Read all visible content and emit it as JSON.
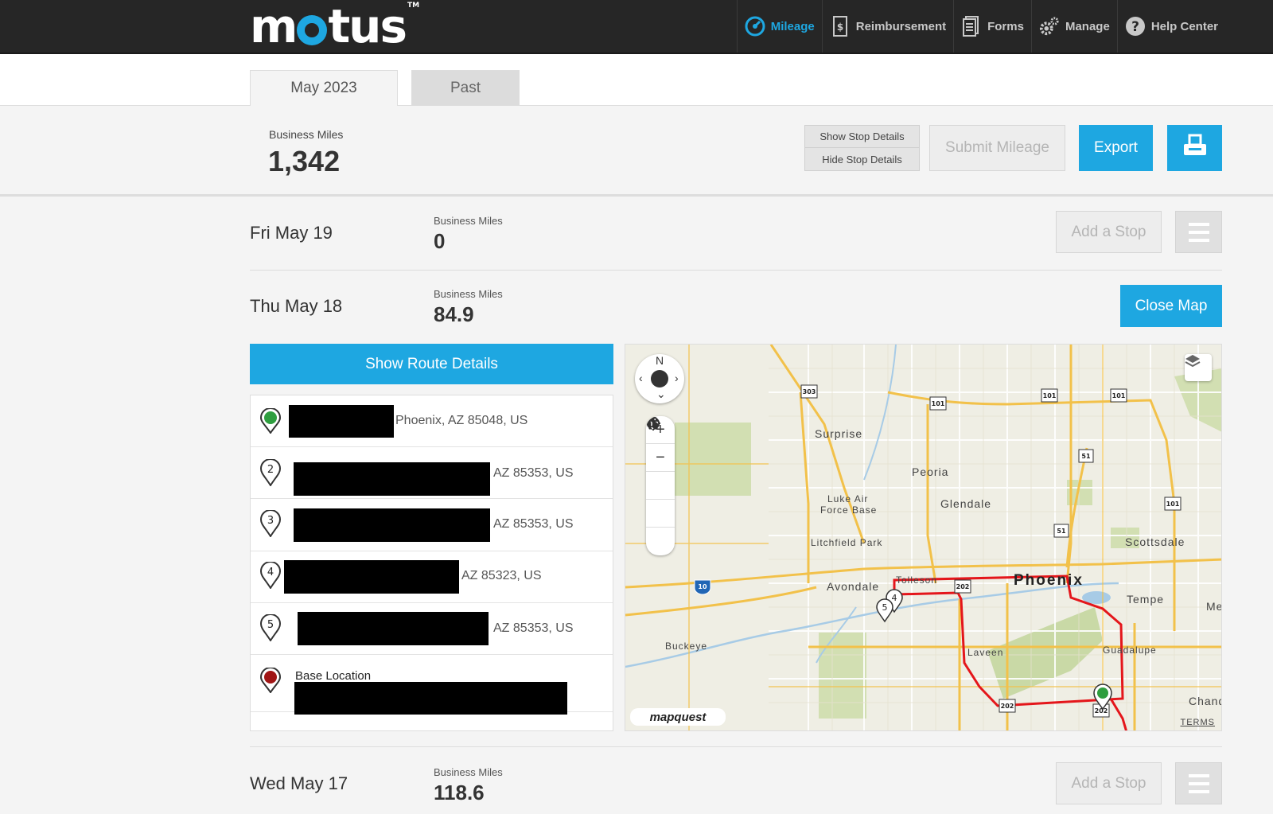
{
  "app": {
    "logo": "motus",
    "trademark": "TM"
  },
  "nav": [
    {
      "label": "Mileage",
      "icon": "dashboard-icon"
    },
    {
      "label": "Reimbursement",
      "icon": "receipt-icon"
    },
    {
      "label": "Forms",
      "icon": "document-icon"
    },
    {
      "label": "Manage",
      "icon": "gears-icon"
    },
    {
      "label": "Help Center",
      "icon": "question-icon"
    }
  ],
  "tabs": {
    "current": "May 2023",
    "past": "Past"
  },
  "summary": {
    "label": "Business Miles",
    "value": "1,342",
    "show_stop_details": "Show Stop Details",
    "hide_stop_details": "Hide Stop Details",
    "submit_label": "Submit Mileage",
    "export_label": "Export"
  },
  "days": [
    {
      "date": "Fri May 19",
      "label": "Business Miles",
      "value": "0",
      "add_stop": "Add a Stop"
    },
    {
      "date": "Thu May 18",
      "label": "Business Miles",
      "value": "84.9",
      "close_map": "Close Map"
    },
    {
      "date": "Wed May 17",
      "label": "Business Miles",
      "value": "118.6",
      "add_stop": "Add a Stop"
    }
  ],
  "route": {
    "show_details": "Show Route Details",
    "stops": [
      {
        "number": "",
        "address": "Phoenix, AZ 85048, US",
        "pin_color": "#2e9e3f"
      },
      {
        "number": "2",
        "address": "AZ 85353, US"
      },
      {
        "number": "3",
        "address": "AZ 85353, US"
      },
      {
        "number": "4",
        "address": "AZ 85323, US"
      },
      {
        "number": "5",
        "address": "AZ 85353, US"
      },
      {
        "number": "",
        "address": "",
        "base_label": "Base Location",
        "pin_color": "#a01515"
      }
    ]
  },
  "map": {
    "compass_n": "N",
    "zoom_in": "+",
    "zoom_out": "−",
    "labels": {
      "surprise": "Surprise",
      "peoria": "Peoria",
      "luke1": "Luke Air",
      "luke2": "Force Base",
      "glendale": "Glendale",
      "litchfield": "Litchfield Park",
      "scottsdale": "Scottsdale",
      "avondale": "Avondale",
      "tolleson": "Tolleson",
      "phoenix": "Phoenix",
      "tempe": "Tempe",
      "me": "Me",
      "buckeye": "Buckeye",
      "laveen": "Laveen",
      "guadalupe": "Guadalupe",
      "chand": "Chand"
    },
    "shields": {
      "s303": "303",
      "s101": "101",
      "s51": "51",
      "s202": "202",
      "s10": "10"
    },
    "logo": "mapquest",
    "terms": "TERMS",
    "route_color": "#e4161b"
  }
}
